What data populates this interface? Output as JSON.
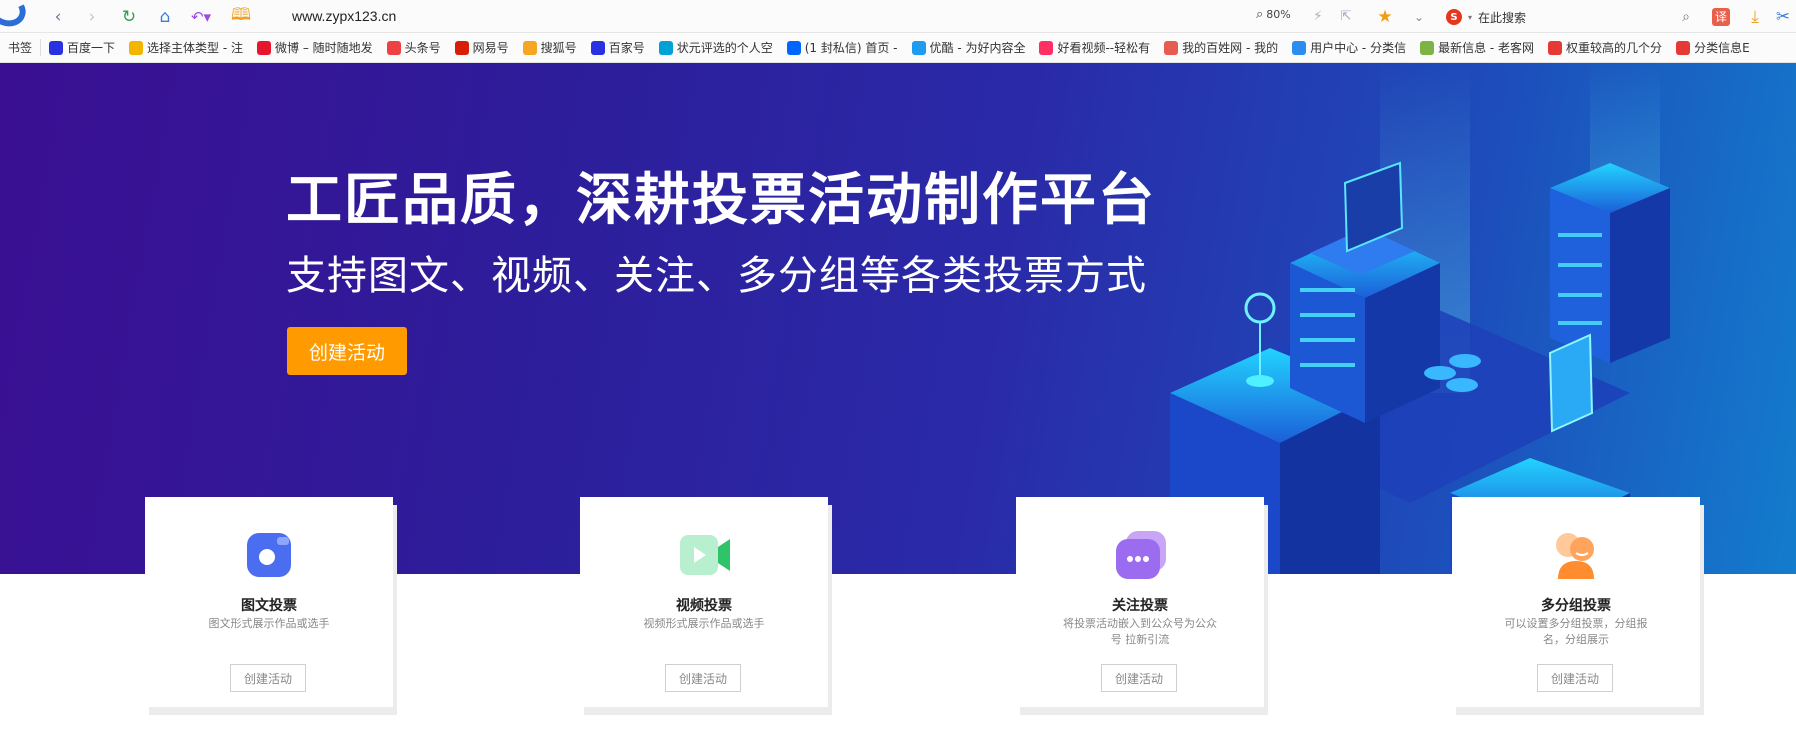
{
  "browser": {
    "address": "www.zypx123.cn",
    "zoom": "80%",
    "search_placeholder": "在此搜索",
    "translate_label": "译"
  },
  "bookmarks": {
    "heading": "书签",
    "items": [
      {
        "label": "百度一下",
        "icon": "baidu-paw-icon",
        "color": "#2932e1"
      },
      {
        "label": "选择主体类型 - 注",
        "icon": "yellow-bell-icon",
        "color": "#f2b500"
      },
      {
        "label": "微博 – 随时随地发",
        "icon": "weibo-icon",
        "color": "#e6162d"
      },
      {
        "label": "头条号",
        "icon": "toutiao-icon",
        "color": "#f04142"
      },
      {
        "label": "网易号",
        "icon": "netease-icon",
        "color": "#d81e06"
      },
      {
        "label": "搜狐号",
        "icon": "sohu-fox-icon",
        "color": "#f5a623"
      },
      {
        "label": "百家号",
        "icon": "baidu-paw-icon",
        "color": "#2932e1"
      },
      {
        "label": "状元评选的个人空",
        "icon": "bilibili-tv-icon",
        "color": "#00a1d6"
      },
      {
        "label": "(1 封私信) 首页 -",
        "icon": "zhihu-icon",
        "color": "#0066ff"
      },
      {
        "label": "优酷 - 为好内容全",
        "icon": "youku-icon",
        "color": "#1f9cf0"
      },
      {
        "label": "好看视频--轻松有",
        "icon": "haokan-play-icon",
        "color": "#ff2e63"
      },
      {
        "label": "我的百姓网 - 我的",
        "icon": "baixing-dots-icon",
        "color": "#e65c4f"
      },
      {
        "label": "用户中心 - 分类信",
        "icon": "s-logo-icon",
        "color": "#2d8cf0"
      },
      {
        "label": "最新信息 - 老客网",
        "icon": "laoke-icon",
        "color": "#7cb342"
      },
      {
        "label": "权重较高的几个分",
        "icon": "c-logo-icon",
        "color": "#e53935"
      },
      {
        "label": "分类信息E",
        "icon": "zhao-icon",
        "color": "#e53935"
      }
    ]
  },
  "banner": {
    "title": "工匠品质，深耕投票活动制作平台",
    "subtitle": "支持图文、视频、关注、多分组等各类投票方式",
    "button": "创建活动"
  },
  "cards": [
    {
      "title": "图文投票",
      "desc": "图文形式展示作品或选手",
      "button": "创建活动",
      "icon": "image-vote-icon"
    },
    {
      "title": "视频投票",
      "desc": "视频形式展示作品或选手",
      "button": "创建活动",
      "icon": "video-camera-icon"
    },
    {
      "title": "关注投票",
      "desc": "将投票活动嵌入到公众号为公众号 拉新引流",
      "button": "创建活动",
      "icon": "chat-bubble-icon"
    },
    {
      "title": "多分组投票",
      "desc": "可以设置多分组投票，分组报名，分组展示",
      "button": "创建活动",
      "icon": "group-users-icon"
    }
  ],
  "colors": {
    "accent_button": "#ff9a00",
    "banner_start": "#3b0f92",
    "banner_end": "#137ccc"
  }
}
